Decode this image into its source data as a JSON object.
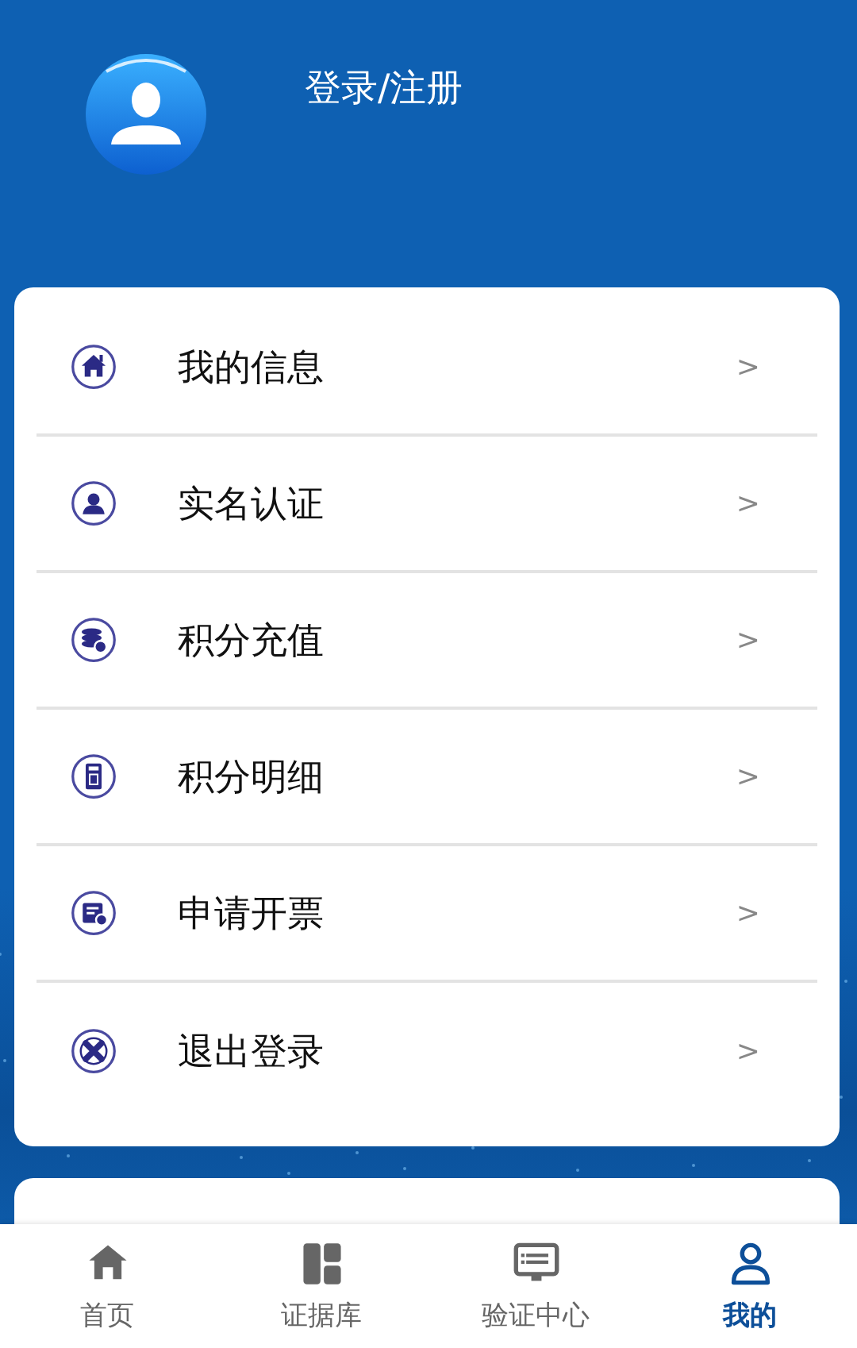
{
  "header": {
    "login_link": "登录/注册"
  },
  "menu": [
    {
      "label": "我的信息",
      "chevron": ">"
    },
    {
      "label": "实名认证",
      "chevron": ">"
    },
    {
      "label": "积分充值",
      "chevron": ">"
    },
    {
      "label": "积分明细",
      "chevron": ">"
    },
    {
      "label": "申请开票",
      "chevron": ">"
    },
    {
      "label": "退出登录",
      "chevron": ">"
    }
  ],
  "tab_bar": [
    {
      "label": "首页",
      "selected": false
    },
    {
      "label": "证据库",
      "selected": false
    },
    {
      "label": "验证中心",
      "selected": false
    },
    {
      "label": "我的",
      "selected": true
    }
  ]
}
